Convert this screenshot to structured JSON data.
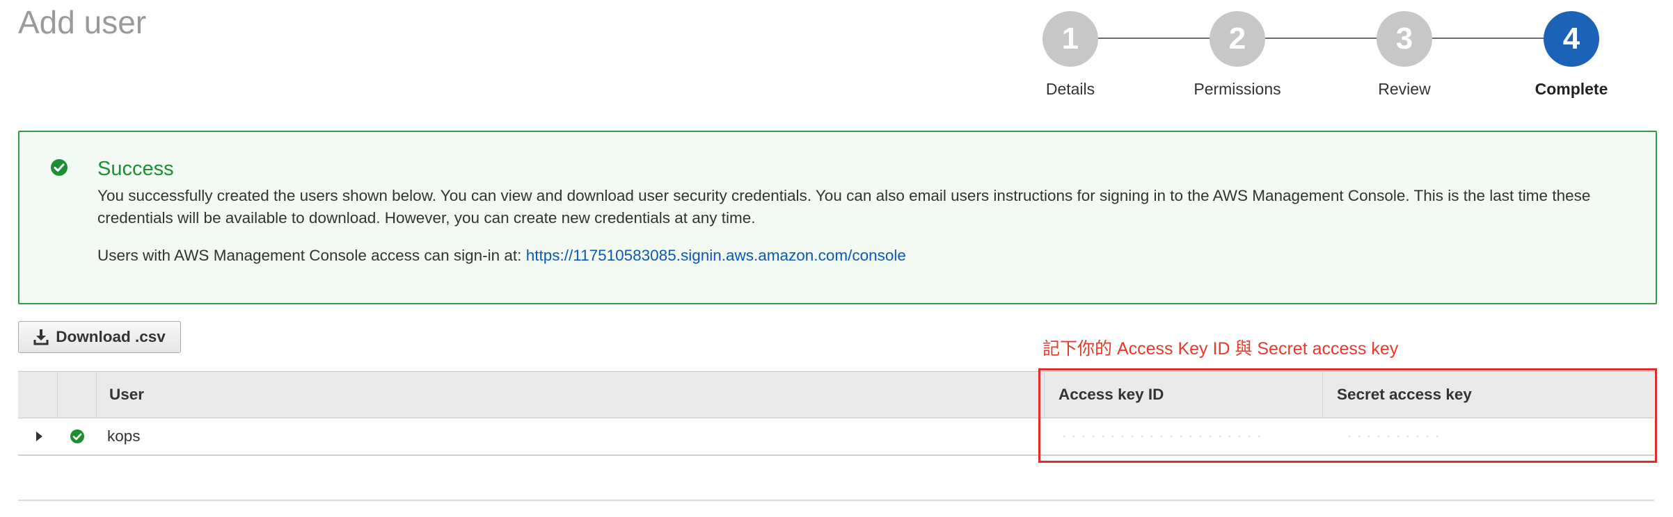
{
  "page": {
    "title": "Add user"
  },
  "stepper": {
    "steps": [
      {
        "number": "1",
        "label": "Details",
        "active": false
      },
      {
        "number": "2",
        "label": "Permissions",
        "active": false
      },
      {
        "number": "3",
        "label": "Review",
        "active": false
      },
      {
        "number": "4",
        "label": "Complete",
        "active": true
      }
    ],
    "active_color": "#1c63b7",
    "inactive_color": "#c7c7c7"
  },
  "success": {
    "icon": "check-circle-icon",
    "title": "Success",
    "message": "You successfully created the users shown below. You can view and download user security credentials. You can also email users instructions for signing in to the AWS Management Console. This is the last time these credentials will be available to download. However, you can create new credentials at any time.",
    "signin_prefix": "Users with AWS Management Console access can sign-in at: ",
    "signin_url": "https://117510583085.signin.aws.amazon.com/console",
    "border_color": "#2f9a43"
  },
  "toolbar": {
    "download_icon": "download-icon",
    "download_label": "Download .csv"
  },
  "annotation": {
    "text": "記下你的 Access Key ID 與 Secret access key",
    "color": "#e83a2a"
  },
  "table": {
    "columns": [
      "",
      "",
      "User",
      "Access key ID",
      "Secret access key"
    ],
    "rows": [
      {
        "expand_icon": "caret-right-icon",
        "status_icon": "check-circle-icon",
        "user": "kops",
        "access_key_id": "",
        "secret_access_key": ""
      }
    ]
  }
}
